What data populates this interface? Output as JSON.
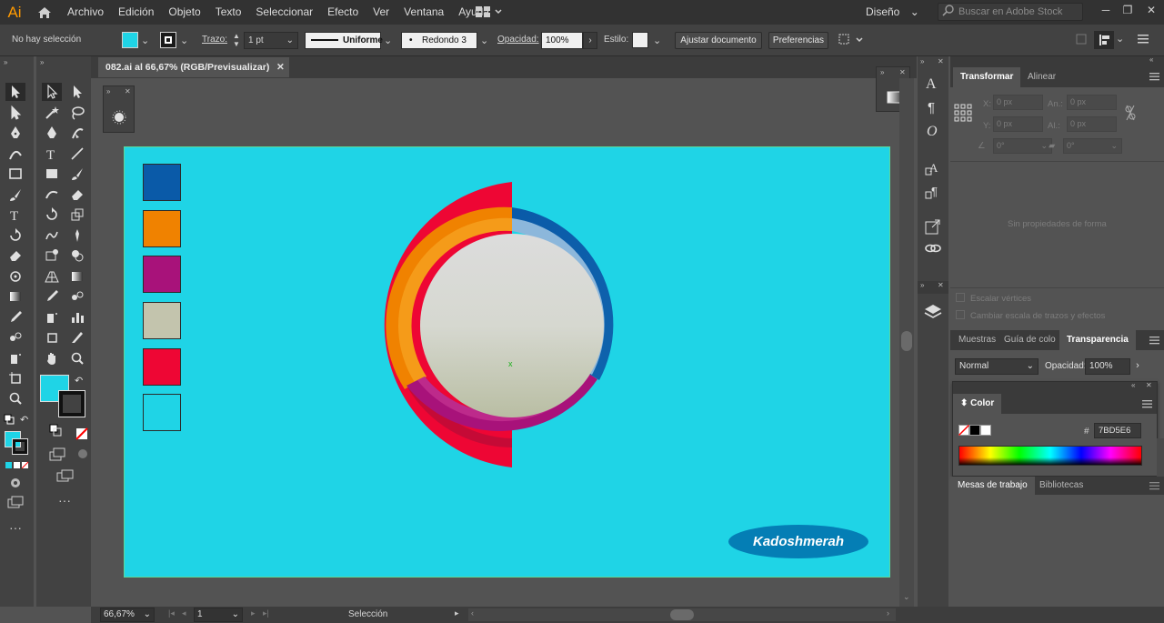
{
  "app": {
    "logo": "Ai"
  },
  "menu": [
    "Archivo",
    "Edición",
    "Objeto",
    "Texto",
    "Seleccionar",
    "Efecto",
    "Ver",
    "Ventana",
    "Ayuda"
  ],
  "workspace": {
    "label": "Diseño"
  },
  "stock_search": {
    "placeholder": "Buscar en Adobe Stock"
  },
  "control": {
    "selection_status": "No hay selección",
    "fill_color": "#1fd4e6",
    "stroke_label": "Trazo:",
    "stroke_weight": "1 pt",
    "stroke_profile": "Uniforme",
    "brush": "Redondo 3 ...",
    "opacity_label": "Opacidad:",
    "opacity_value": "100%",
    "style_label": "Estilo:",
    "adjust_doc_button": "Ajustar documento",
    "prefs_button": "Preferencias"
  },
  "document": {
    "tab_title": "082.ai al 66,67% (RGB/Previsualizar)",
    "artboard_color": "#1fd4e6",
    "swatches": [
      "#0a5aa8",
      "#f08200",
      "#a8127a",
      "#c3c4ad",
      "#ee0634",
      "#1fd4e6"
    ],
    "signature": "Kadoshmerah"
  },
  "toolbar": {
    "fill_color": "#1fd4e6",
    "stroke_color": "#000000"
  },
  "panels": {
    "top_tabs": [
      "Transformar",
      "Alinear"
    ],
    "transform": {
      "x_label": "X:",
      "x_value": "0 px",
      "y_label": "Y:",
      "y_value": "0 px",
      "w_label": "An.:",
      "w_value": "0 px",
      "h_label": "Al.:",
      "h_value": "0 px",
      "angle_value": "0°",
      "shear_value": "0°",
      "no_shape_props": "Sin propiedades de forma",
      "scale_corners": "Escalar vértices",
      "scale_strokes": "Cambiar escala de trazos y efectos"
    },
    "mid_tabs": [
      "Muestras",
      "Guía de colo",
      "Transparencia"
    ],
    "transparency": {
      "mode": "Normal",
      "opacity_label": "Opacidad:",
      "opacity_value": "100%"
    },
    "color": {
      "title": "Color",
      "hex_label": "#",
      "hex_value": "7BD5E6"
    },
    "bottom_tabs": [
      "Mesas de trabajo",
      "Bibliotecas"
    ]
  },
  "status": {
    "zoom": "66,67%",
    "artboard_number": "1",
    "tool_name": "Selección"
  }
}
